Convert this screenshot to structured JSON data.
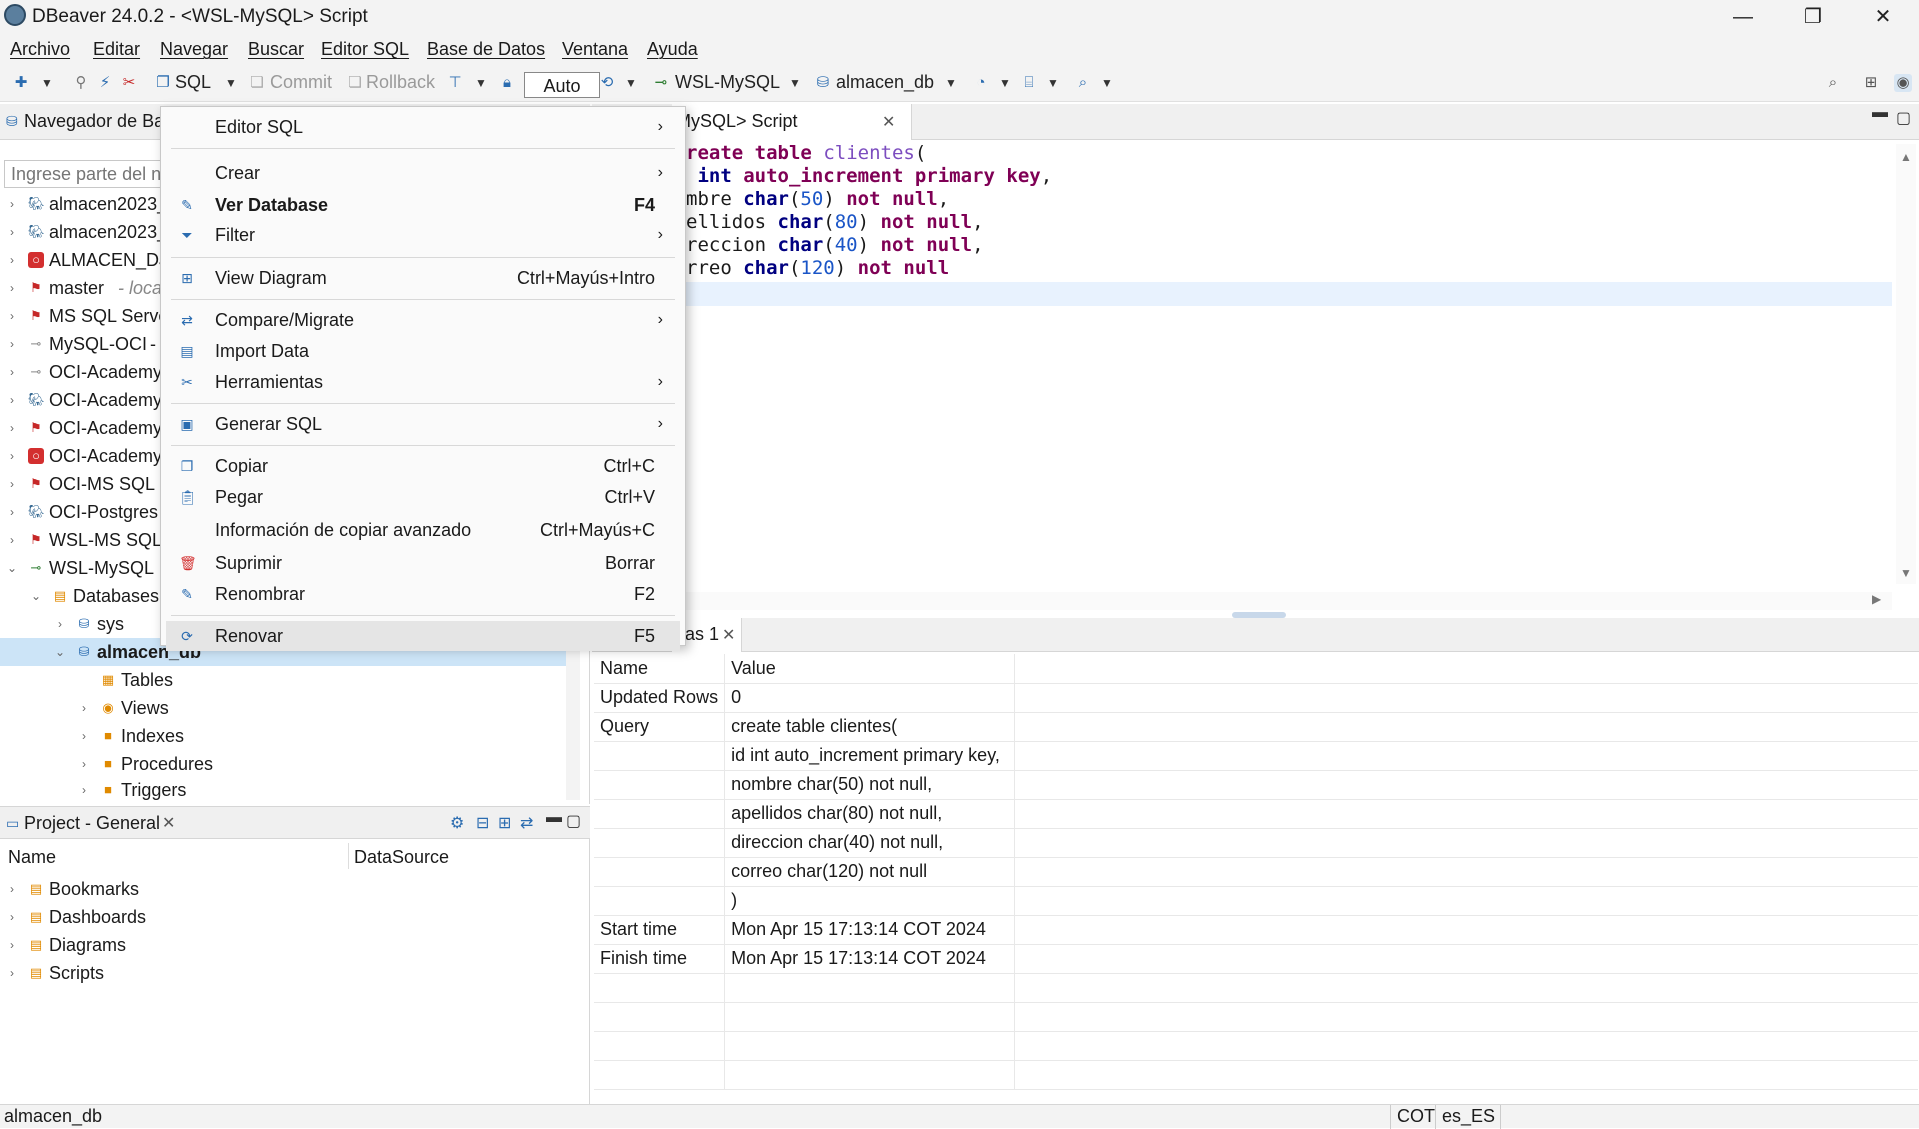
{
  "window": {
    "title": "DBeaver 24.0.2 - <WSL-MySQL> Script",
    "min_label": "—",
    "max_label": "❐",
    "close_label": "✕"
  },
  "menubar": [
    "Archivo",
    "Editar",
    "Navegar",
    "Buscar",
    "Editor SQL",
    "Base de Datos",
    "Ventana",
    "Ayuda"
  ],
  "toolbar": {
    "sql": "SQL",
    "commit": "Commit",
    "rollback": "Rollback",
    "auto": "Auto",
    "connection": "WSL-MySQL",
    "database": "almacen_db"
  },
  "navigator": {
    "title": "Navegador de Ba",
    "filter_placeholder": "Ingrese parte del n",
    "items": [
      {
        "label": "almacen2023_",
        "extra": ""
      },
      {
        "label": "almacen2023_",
        "extra": ""
      },
      {
        "label": "ALMACEN_DJ",
        "extra": ""
      },
      {
        "label": "master",
        "extra": "- loca"
      },
      {
        "label": "MS SQL Serve",
        "extra": ""
      },
      {
        "label": "MySQL-OCI",
        "extra": "-"
      },
      {
        "label": "OCI-Academy",
        "extra": ""
      },
      {
        "label": "OCI-Academy",
        "extra": ""
      },
      {
        "label": "OCI-Academy",
        "extra": ""
      },
      {
        "label": "OCI-Academy",
        "extra": ""
      },
      {
        "label": "OCI-MS SQL S",
        "extra": ""
      },
      {
        "label": "OCI-Postgres",
        "extra": ""
      },
      {
        "label": "WSL-MS SQL",
        "extra": ""
      },
      {
        "label": "WSL-MySQL",
        "extra": ""
      },
      {
        "label": "Databases",
        "extra": ""
      },
      {
        "label": "sys",
        "extra": ""
      },
      {
        "label": "almacen_db",
        "extra": ""
      },
      {
        "label": "Tables",
        "extra": ""
      },
      {
        "label": "Views",
        "extra": ""
      },
      {
        "label": "Indexes",
        "extra": ""
      },
      {
        "label": "Procedures",
        "extra": ""
      },
      {
        "label": "Triggers",
        "extra": ""
      }
    ]
  },
  "project": {
    "title": "Project - General",
    "col_name": "Name",
    "col_datasource": "DataSource",
    "items": [
      "Bookmarks",
      "Dashboards",
      "Diagrams",
      "Scripts"
    ]
  },
  "editor": {
    "tab": "MySQL> Script"
  },
  "results": {
    "tab": "cas 1",
    "header": [
      "Name",
      "Value"
    ],
    "rows": [
      [
        "Updated Rows",
        "0"
      ],
      [
        "Query",
        "create table clientes("
      ],
      [
        "",
        "id int auto_increment primary key,"
      ],
      [
        "",
        "nombre char(50) not null,"
      ],
      [
        "",
        "apellidos char(80) not null,"
      ],
      [
        "",
        "direccion char(40) not null,"
      ],
      [
        "",
        "correo char(120) not null"
      ],
      [
        "",
        ")"
      ],
      [
        "Start time",
        "Mon Apr 15 17:13:14 COT 2024"
      ],
      [
        "Finish time",
        "Mon Apr 15 17:13:14 COT 2024"
      ]
    ]
  },
  "context_menu": [
    {
      "label": "Editor SQL",
      "shortcut": "",
      "submenu": true,
      "bold": false,
      "icon": "none"
    },
    {
      "label": "Crear",
      "shortcut": "",
      "submenu": true,
      "bold": false,
      "icon": "none"
    },
    {
      "label": "Ver Database",
      "shortcut": "F4",
      "submenu": false,
      "bold": true,
      "icon": "pencil-icon"
    },
    {
      "label": "Filter",
      "shortcut": "",
      "submenu": true,
      "bold": false,
      "icon": "filter-icon"
    },
    {
      "label": "View Diagram",
      "shortcut": "Ctrl+Mayús+Intro",
      "submenu": false,
      "bold": false,
      "icon": "diagram-icon"
    },
    {
      "label": "Compare/Migrate",
      "shortcut": "",
      "submenu": true,
      "bold": false,
      "icon": "compare-icon"
    },
    {
      "label": "Import Data",
      "shortcut": "",
      "submenu": false,
      "bold": false,
      "icon": "import-icon"
    },
    {
      "label": "Herramientas",
      "shortcut": "",
      "submenu": true,
      "bold": false,
      "icon": "tools-icon"
    },
    {
      "label": "Generar SQL",
      "shortcut": "",
      "submenu": true,
      "bold": false,
      "icon": "sql-icon"
    },
    {
      "label": "Copiar",
      "shortcut": "Ctrl+C",
      "submenu": false,
      "bold": false,
      "icon": "copy-icon"
    },
    {
      "label": "Pegar",
      "shortcut": "Ctrl+V",
      "submenu": false,
      "bold": false,
      "icon": "paste-icon"
    },
    {
      "label": "Información de copiar avanzado",
      "shortcut": "Ctrl+Mayús+C",
      "submenu": false,
      "bold": false,
      "icon": "none"
    },
    {
      "label": "Suprimir",
      "shortcut": "Borrar",
      "submenu": false,
      "bold": false,
      "icon": "delete-icon"
    },
    {
      "label": "Renombrar",
      "shortcut": "F2",
      "submenu": false,
      "bold": false,
      "icon": "rename-icon"
    },
    {
      "label": "Renovar",
      "shortcut": "F5",
      "submenu": false,
      "bold": false,
      "icon": "refresh-icon"
    }
  ],
  "status": {
    "left": "almacen_db",
    "tz": "COT",
    "locale": "es_ES"
  },
  "colors": {
    "keyword": "#7f0055",
    "type": "#000080",
    "identifier": "#7c4dbf",
    "number": "#1a55c7",
    "selection": "#cce4f7"
  }
}
